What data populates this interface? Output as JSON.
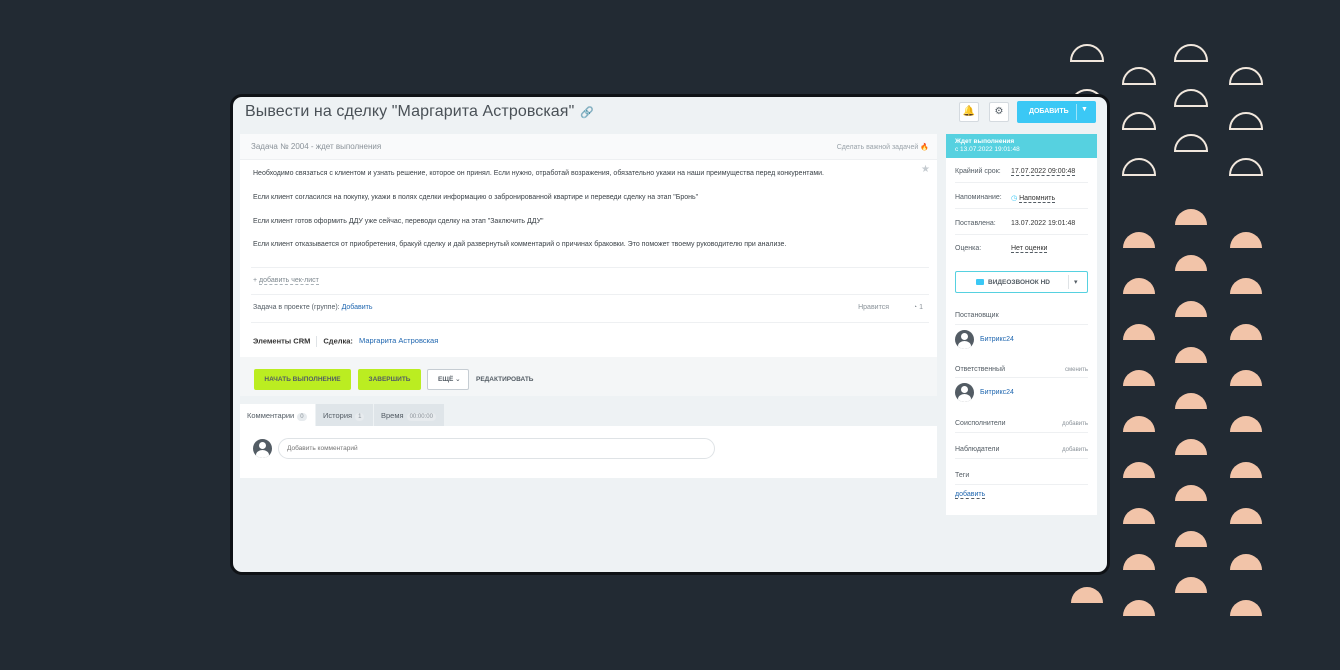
{
  "colors": {
    "background": "#222a33",
    "accent_blue": "#3bc8f5",
    "accent_green": "#bbed21",
    "status_teal": "#56d1e0",
    "deco_outline": "#f1e7dd",
    "deco_fill": "#f2c4a9"
  },
  "task": {
    "title": "Вывести на сделку \"Маргарита Астровская\"",
    "number_status": "Задача № 2004 - ждет выполнения",
    "make_important": "Сделать важной задачей",
    "description": [
      "Необходимо связаться с клиентом и узнать решение, которое он принял. Если нужно, отработай возражения, обязательно укажи на наши преимущества перед конкурентами.",
      "Если клиент согласился на покупку, укажи в полях сделки информацию о забронированной квартире и переведи сделку на этап \"Бронь\"",
      "Если клиент готов оформить ДДУ уже сейчас, переводи сделку на этап \"Заключить ДДУ\"",
      "Если клиент отказывается от приобретения, бракуй сделку и дай развернутый комментарий о причинах браковки. Это поможет твоему руководителю при анализе."
    ],
    "add_checklist": "добавить чек-лист",
    "project_label": "Задача в проекте (группе):",
    "project_add": "Добавить",
    "likes_label": "Нравится",
    "likes_count": "1",
    "crm_label": "Элементы CRM",
    "deal_label": "Сделка:",
    "deal_name": "Маргарита Астровская"
  },
  "toolbar": {
    "add_label": "ДОБАВИТЬ"
  },
  "actions": {
    "start": "НАЧАТЬ ВЫПОЛНЕНИЕ",
    "finish": "ЗАВЕРШИТЬ",
    "more": "ЕЩЁ",
    "edit": "РЕДАКТИРОВАТЬ"
  },
  "tabs": [
    {
      "label": "Комментарии",
      "count": "0"
    },
    {
      "label": "История",
      "count": "1"
    },
    {
      "label": "Время",
      "count": "00:00:00"
    }
  ],
  "comment_placeholder": "Добавить комментарий",
  "sidebar": {
    "status_title": "Ждет выполнения",
    "status_since": "с 13.07.2022 19:01:48",
    "deadline_label": "Крайний срок:",
    "deadline_value": "17.07.2022 09:00:48",
    "reminder_label": "Напоминание:",
    "reminder_value": "Напомнить",
    "created_label": "Поставлена:",
    "created_value": "13.07.2022 19:01:48",
    "rating_label": "Оценка:",
    "rating_value": "Нет оценки",
    "video_label": "ВИДЕОЗВОНОК HD",
    "creator_title": "Постановщик",
    "creator_name": "Битрикс24",
    "responsible_title": "Ответственный",
    "responsible_change": "сменить",
    "responsible_name": "Битрикс24",
    "coexecutors_title": "Соисполнители",
    "coexecutors_add": "добавить",
    "observers_title": "Наблюдатели",
    "observers_add": "добавить",
    "tags_title": "Теги",
    "tags_add": "добавить"
  }
}
